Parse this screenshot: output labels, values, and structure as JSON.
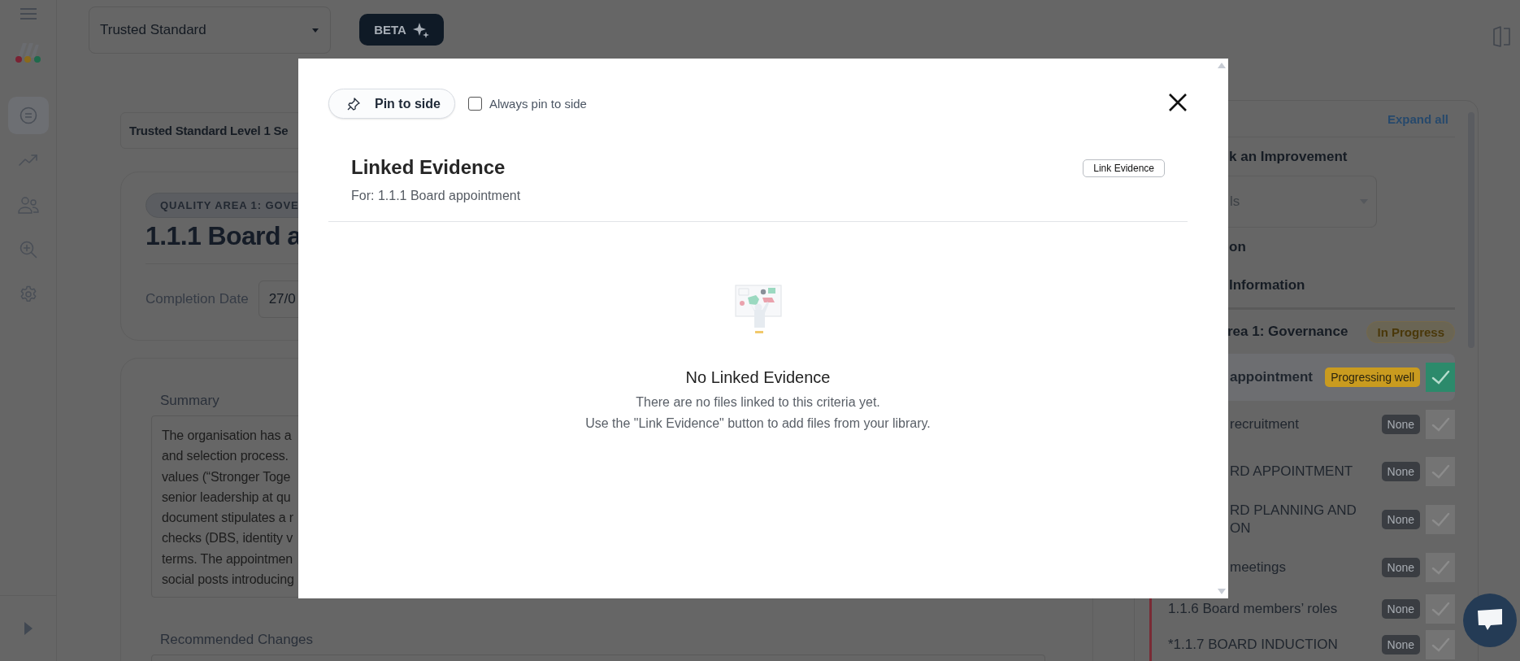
{
  "top_bar": {
    "standard_select": {
      "value": "Trusted Standard"
    },
    "beta_button": {
      "label": "BETA"
    }
  },
  "sidebar": {
    "items": [
      {
        "kind": "chat",
        "selected": true
      },
      {
        "kind": "trend",
        "selected": false
      },
      {
        "kind": "people",
        "selected": false
      },
      {
        "kind": "zoom",
        "selected": false
      },
      {
        "kind": "settings",
        "selected": false
      }
    ]
  },
  "page": {
    "breadcrumb": "Trusted Standard Level 1 Se",
    "criterion": {
      "area_badge": "QUALITY AREA 1: GOVE",
      "title": "1.1.1 Board a",
      "completion_label": "Completion Date",
      "completion_value": "27/0"
    },
    "summary": {
      "label": "Summary",
      "value": "The organisation has a\nand selection process.\nvalues (“Stronger Toge\nsenior leadership at qu\ndocument stipulates a r\nchecks (DBS, identity v\nterms. The appointmen\nsocial posts introducing"
    },
    "recommended_changes": {
      "label": "Recommended Changes"
    }
  },
  "side_panel": {
    "expand_all": "Expand all",
    "sections": [
      {
        "kind": "heading",
        "label": "k an Improvement"
      },
      {
        "kind": "select",
        "label": "ls"
      },
      {
        "kind": "heading",
        "label": "on"
      },
      {
        "kind": "heading",
        "label": "Information"
      }
    ],
    "area": {
      "title": "rea 1: Governance",
      "status": "In Progress"
    },
    "criteria": [
      {
        "label": "appointment",
        "status": "Progressing well",
        "color": "#c99b1f",
        "checked": true,
        "selected": true
      },
      {
        "label": "recruitment",
        "status": "None",
        "color": "#3a3d42",
        "checked": false,
        "selected": false
      },
      {
        "label": "RD APPOINTMENT",
        "status": "None",
        "color": "#3a3d42",
        "checked": false,
        "selected": false
      },
      {
        "label": "RD PLANNING AND ON",
        "status": "None",
        "color": "#3a3d42",
        "checked": false,
        "selected": false
      },
      {
        "label": "meetings",
        "status": "None",
        "color": "#3a3d42",
        "checked": false,
        "selected": false
      },
      {
        "label": "1.1.6 Board members’ roles",
        "status": "None",
        "color": "#3a3d42",
        "checked": false,
        "selected": false
      },
      {
        "label": "*1.1.7 BOARD INDUCTION",
        "status": "None",
        "color": "#3a3d42",
        "checked": false,
        "selected": false
      }
    ]
  },
  "modal": {
    "pin_button": "Pin to side",
    "always_pin": {
      "label": "Always pin to side",
      "checked": false
    },
    "title": "Linked Evidence",
    "subtitle": "For: 1.1.1 Board appointment",
    "link_button": "Link Evidence",
    "empty_title": "No Linked Evidence",
    "empty_lines": [
      "There are no files linked to this criteria yet.",
      "Use the \"Link Evidence\" button to add files from your library."
    ]
  }
}
